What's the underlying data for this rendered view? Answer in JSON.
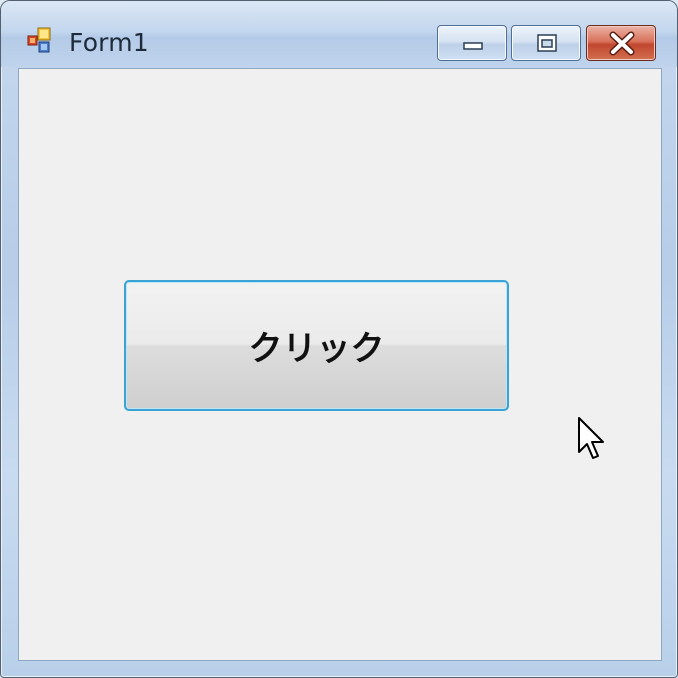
{
  "window": {
    "title": "Form1",
    "icon": "app-form-icon",
    "controls": {
      "minimize_icon": "minimize-icon",
      "maximize_icon": "maximize-icon",
      "close_icon": "close-icon"
    }
  },
  "form": {
    "button_label": "クリック"
  },
  "colors": {
    "client_background": "#f0f0f0",
    "button_focus_border": "#3aa3d6",
    "close_button": "#c0472f"
  }
}
